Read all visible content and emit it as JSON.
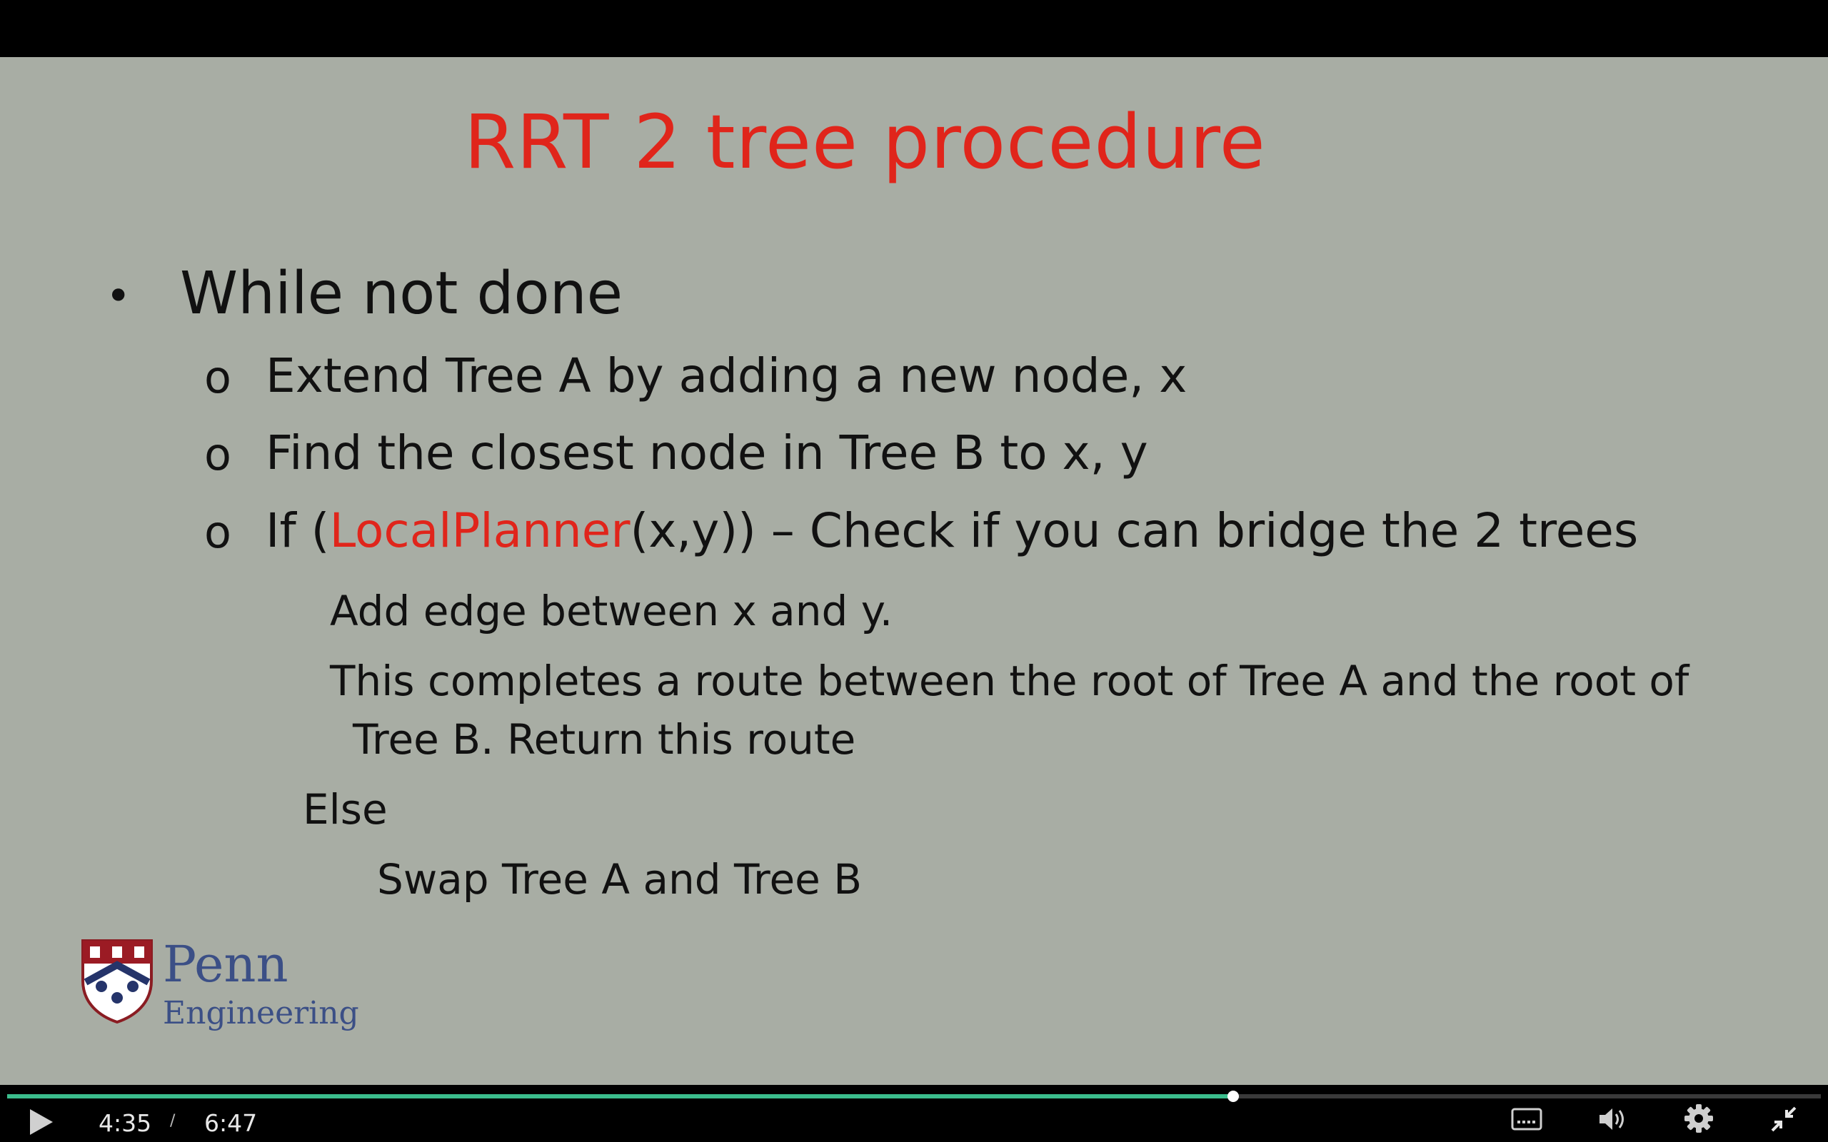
{
  "slide": {
    "title": "RRT 2 tree procedure",
    "bullet_symbol": "•",
    "sub_bullet_symbol": "o",
    "main_bullet": "While not done",
    "sub_items": {
      "extend": "Extend Tree A by adding a new node, x",
      "find": "Find the closest node in Tree B to x, y",
      "if_prefix": "If (",
      "if_fn": "LocalPlanner",
      "if_suffix": "(x,y)) – Check if you can bridge the 2 trees"
    },
    "then_lines": {
      "add_edge": "Add edge between x and y.",
      "completes_1": "This completes a route between the root of Tree A and the root of",
      "completes_2": "Tree B. Return this route"
    },
    "else_label": "Else",
    "else_line": "Swap Tree A and Tree B",
    "logo": {
      "name": "Penn",
      "sub": "Engineering"
    }
  },
  "player": {
    "current_time": "4:35",
    "time_separator": "/",
    "total_time": "6:47",
    "progress": 0.676,
    "accent_color": "#3bbd8c",
    "icons": [
      "play-icon",
      "captions-icon",
      "volume-icon",
      "settings-icon",
      "exit-fullscreen-icon"
    ]
  }
}
